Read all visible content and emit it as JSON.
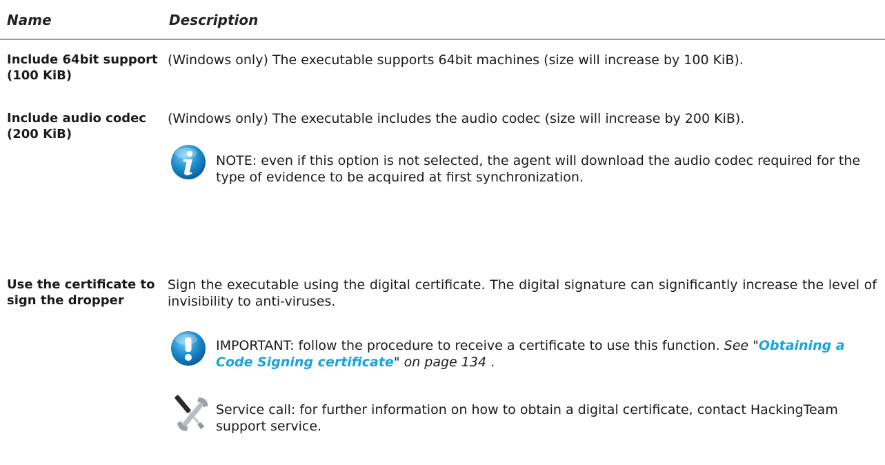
{
  "header": {
    "name_col": "Name",
    "desc_col": "Description"
  },
  "rows": [
    {
      "name": "Include 64bit support (100 KiB)",
      "description": "(Windows only) The executable supports 64bit machines (size will increase by 100 KiB)."
    },
    {
      "name": "Include audio codec (200 KiB)",
      "description": "(Windows only) The executable includes the audio codec (size will increase by 200 KiB).",
      "note": {
        "icon": "info-icon",
        "text": "NOTE: even if this option is not selected, the agent will download the audio codec required for the type of evidence to be acquired at first synchronization."
      }
    },
    {
      "name": "Use the certificate to sign the dropper",
      "description": "Sign the executable using the digital certificate. The digital signature can significantly increase the level of invisibility to anti-viruses.",
      "important": {
        "icon": "important-icon",
        "text": "IMPORTANT: follow the procedure to receive a certificate to use this function.",
        "ref_prefix": "See \"",
        "ref_link": "Obtaining a Code Signing certificate",
        "ref_suffix": "\" on page 134",
        "ref_end": " ."
      },
      "service": {
        "icon": "tools-icon",
        "text": "Service call: for further information on how to obtain a digital certificate, contact HackingTeam support service."
      }
    }
  ],
  "colors": {
    "link": "#1aa3dc",
    "info_icon": "#1f8fd0",
    "rule": "#9a9a9a"
  }
}
